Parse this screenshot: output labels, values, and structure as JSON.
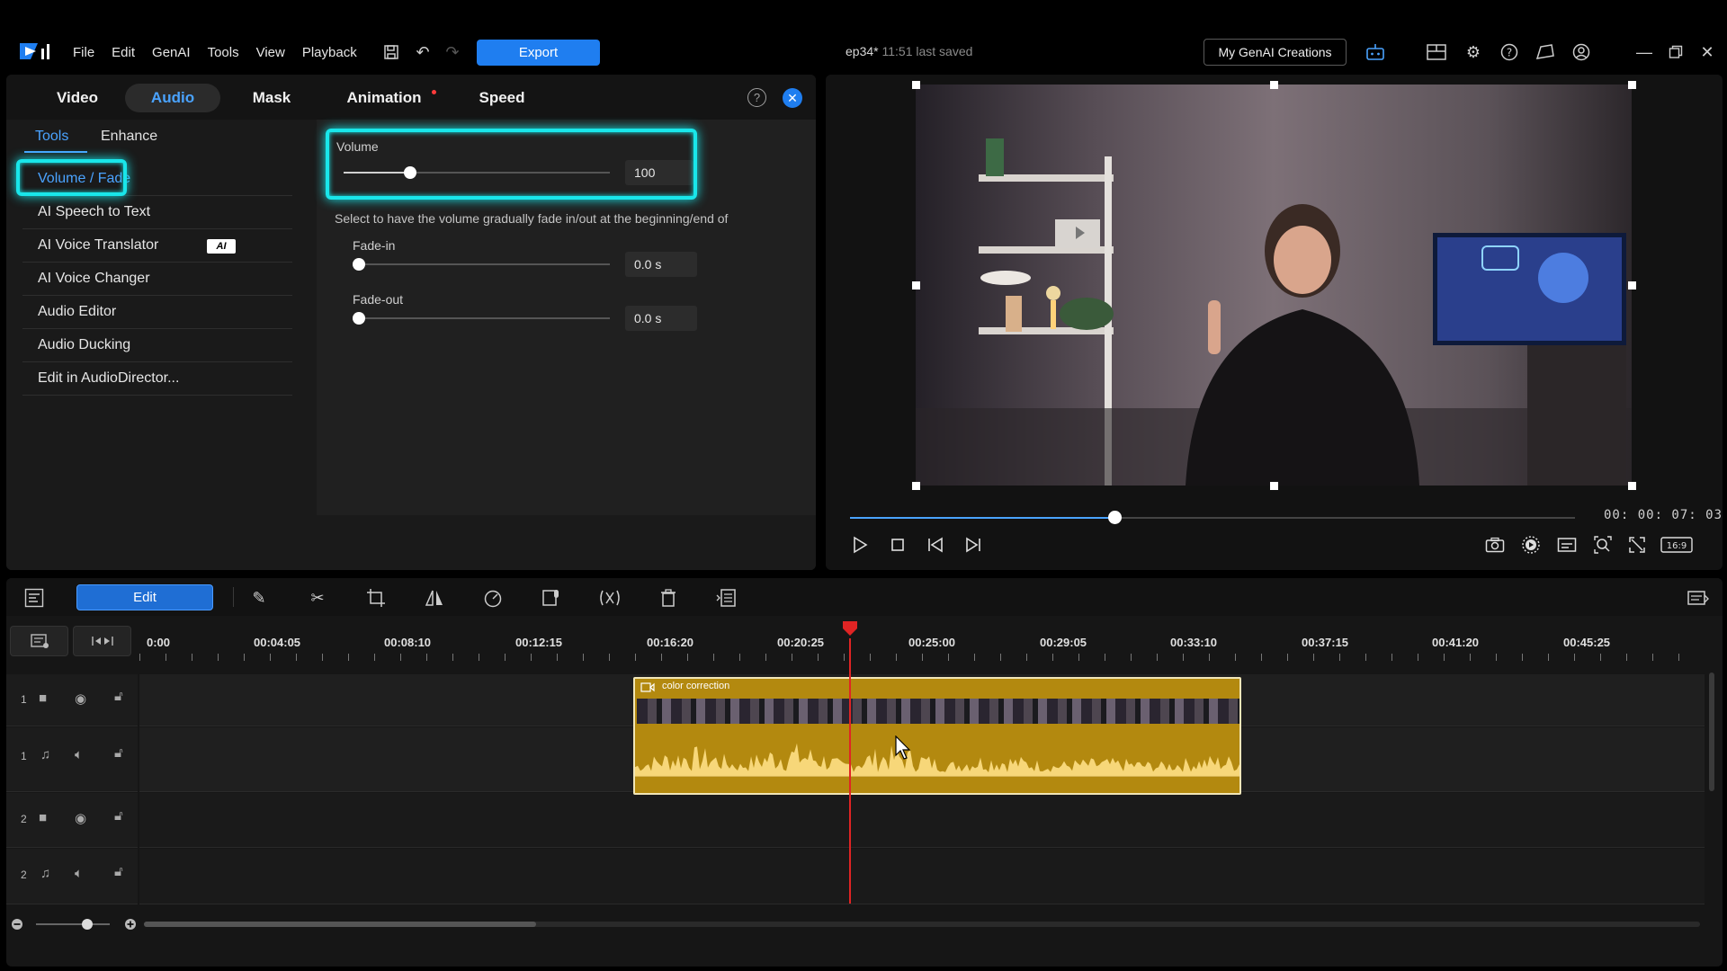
{
  "menubar": {
    "items": [
      "File",
      "Edit",
      "GenAI",
      "Tools",
      "View",
      "Playback"
    ],
    "export_label": "Export",
    "project_name": "ep34*",
    "saved_status": "11:51 last saved",
    "genai_button": "My GenAI Creations"
  },
  "panel": {
    "tabs": [
      {
        "label": "Video"
      },
      {
        "label": "Audio"
      },
      {
        "label": "Mask"
      },
      {
        "label": "Animation"
      },
      {
        "label": "Speed"
      }
    ],
    "subtabs": [
      "Tools",
      "Enhance"
    ],
    "tools": [
      {
        "label": "Volume / Fade"
      },
      {
        "label": "AI Speech to Text"
      },
      {
        "label": "AI Voice Translator",
        "badge": "AI"
      },
      {
        "label": "AI Voice Changer"
      },
      {
        "label": "Audio Editor"
      },
      {
        "label": "Audio Ducking"
      },
      {
        "label": "Edit in AudioDirector..."
      }
    ],
    "volume": {
      "label": "Volume",
      "value": "100",
      "level": 0.25
    },
    "fade_description": "Select to have the volume gradually fade in/out at the beginning/end of",
    "fade_in": {
      "label": "Fade-in",
      "value": "0.0 s"
    },
    "fade_out": {
      "label": "Fade-out",
      "value": "0.0 s"
    }
  },
  "preview": {
    "timecode": "00: 00: 07: 03",
    "progress": 0.365,
    "aspect": "16:9"
  },
  "timeline": {
    "edit_label": "Edit",
    "ruler": [
      "0:00",
      "00:04:05",
      "00:08:10",
      "00:12:15",
      "00:16:20",
      "00:20:25",
      "00:25:00",
      "00:29:05",
      "00:33:10",
      "00:37:15",
      "00:41:20",
      "00:45:25"
    ],
    "tracks": [
      {
        "num": "1",
        "type": "video"
      },
      {
        "num": "1",
        "type": "audio"
      },
      {
        "num": "2",
        "type": "video"
      },
      {
        "num": "2",
        "type": "audio"
      }
    ],
    "clip_title": "color correction"
  },
  "colors": {
    "accent": "#1f7ef0",
    "highlight": "#19e6ea",
    "clip": "#b3890f",
    "playhead": "#e02424"
  }
}
